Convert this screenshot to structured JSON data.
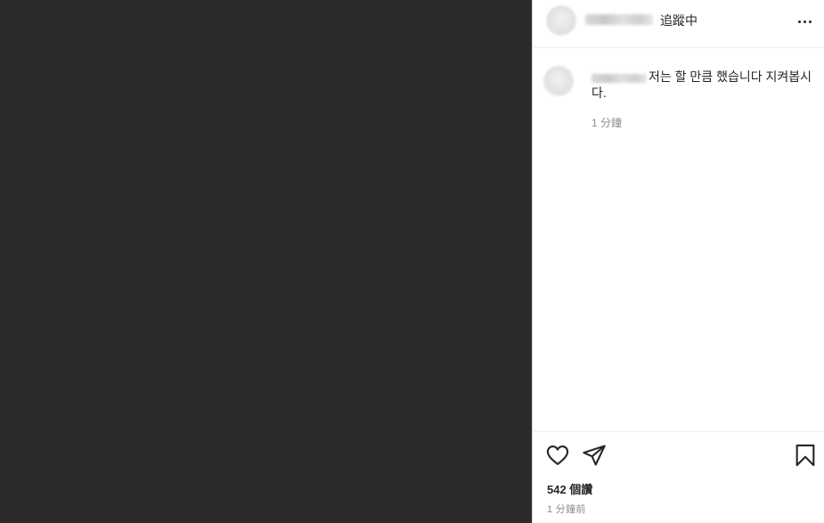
{
  "header": {
    "follow_status": "追蹤中"
  },
  "comment": {
    "text": "저는 할 만큼 했습니다 지켜봅시다.",
    "time": "1 分鐘"
  },
  "footer": {
    "likes": "542 個讚",
    "time_ago": "1 分鐘前"
  },
  "icons": {
    "more": "more-options-icon",
    "like": "heart-icon",
    "share": "send-icon",
    "save": "bookmark-icon"
  },
  "colors": {
    "media_background": "#2b2b2b",
    "text": "#262626",
    "secondary_text": "#8e8e8e"
  }
}
